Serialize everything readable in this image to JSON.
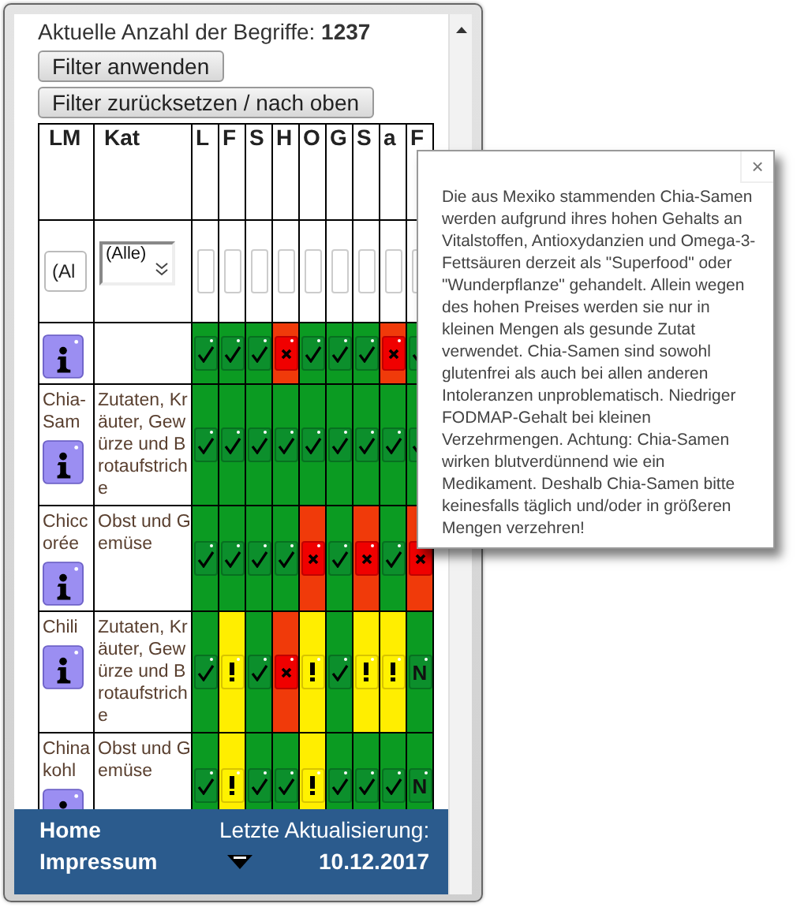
{
  "count_text": "Aktuelle Anzahl der Begriffe: **1237**",
  "buttons": [
    "Filter anwenden",
    "Filter zurücksetzen / nach oben"
  ],
  "table": {
    "columns": [
      {
        "label": "LM"
      },
      {
        "label": "Kat"
      }
    ],
    "check_columns": [
      {
        "label": "L"
      },
      {
        "label": "F"
      },
      {
        "label": "S"
      },
      {
        "label": "H"
      },
      {
        "label": "O"
      },
      {
        "label": "G"
      },
      {
        "label": "S"
      },
      {
        "label": "a"
      },
      {
        "label": "F"
      }
    ],
    "filters": {
      "lm_placeholder": "(Al",
      "kat_value": "(Alle)"
    },
    "rows": [
      {
        "cells": [
          {
            "kind": "ok"
          },
          {
            "kind": "ok"
          },
          {
            "kind": "ok"
          },
          {
            "kind": "bad"
          },
          {
            "kind": "ok"
          },
          {
            "kind": "ok"
          },
          {
            "kind": "ok"
          },
          {
            "kind": "bad"
          },
          {
            "kind": "ok"
          }
        ]
      },
      {
        "name": "Chia-Sam",
        "category": "Zutaten, Kräuter, Gewürze und Brotaufstriche",
        "cells": [
          {
            "kind": "ok"
          },
          {
            "kind": "ok"
          },
          {
            "kind": "ok"
          },
          {
            "kind": "ok"
          },
          {
            "kind": "ok"
          },
          {
            "kind": "ok"
          },
          {
            "kind": "ok"
          },
          {
            "kind": "ok"
          },
          {
            "kind": "ok"
          }
        ]
      },
      {
        "name": "Chiccorée",
        "category": "Obst und Gemüse",
        "cells": [
          {
            "kind": "ok"
          },
          {
            "kind": "ok"
          },
          {
            "kind": "ok"
          },
          {
            "kind": "ok"
          },
          {
            "kind": "bad"
          },
          {
            "kind": "ok"
          },
          {
            "kind": "bad"
          },
          {
            "kind": "ok"
          },
          {
            "kind": "bad"
          }
        ]
      },
      {
        "name": "Chili",
        "category": "Zutaten, Kräuter, Gewürze und Brotaufstriche",
        "cells": [
          {
            "kind": "ok"
          },
          {
            "kind": "warn"
          },
          {
            "kind": "ok"
          },
          {
            "kind": "bad"
          },
          {
            "kind": "warn"
          },
          {
            "kind": "ok"
          },
          {
            "kind": "warn"
          },
          {
            "kind": "warn"
          },
          {
            "kind": "text",
            "label": "N"
          }
        ]
      },
      {
        "name": "Chinakohl",
        "category": "Obst und Gemüse",
        "cells": [
          {
            "kind": "ok"
          },
          {
            "kind": "warn"
          },
          {
            "kind": "ok"
          },
          {
            "kind": "ok"
          },
          {
            "kind": "warn"
          },
          {
            "kind": "ok"
          },
          {
            "kind": "ok"
          },
          {
            "kind": "ok"
          },
          {
            "kind": "text",
            "label": "N"
          }
        ]
      }
    ]
  },
  "popup": {
    "close": "×",
    "text": "Die aus Mexiko stammenden Chia-Samen werden aufgrund ihres hohen Gehalts an Vitalstoffen, Antioxydanzien und Omega-3-Fettsäuren derzeit als \"Superfood\" oder \"Wunderpflanze\" gehandelt. Allein wegen des hohen Preises werden sie nur in kleinen Mengen als gesunde Zutat verwendet. Chia-Samen sind sowohl glutenfrei als auch bei allen anderen Intoleranzen unproblematisch. Niedriger FODMAP-Gehalt bei kleinen Verzehrmengen. Achtung: Chia-Samen wirken blutverdünnend wie ein Medikament. Deshalb Chia-Samen bitte keinesfalls täglich und/oder in größeren Mengen verzehren!"
  },
  "footer": {
    "links": [
      "Home",
      "Impressum"
    ],
    "update_label": "Letzte Aktualisierung:",
    "update_date": "10.12.2017"
  }
}
